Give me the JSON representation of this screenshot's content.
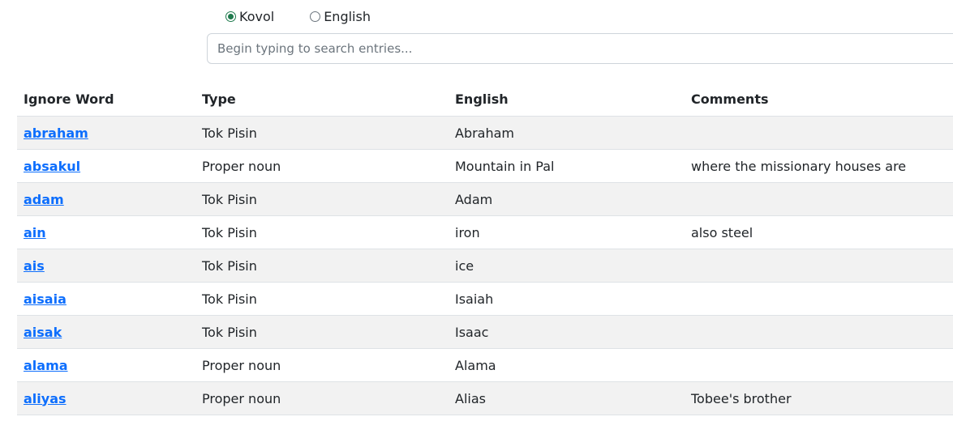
{
  "language_toggle": {
    "options": [
      {
        "label": "Kovol",
        "checked": true
      },
      {
        "label": "English",
        "checked": false
      }
    ],
    "accent_color": "#1f7a4d"
  },
  "search": {
    "placeholder": "Begin typing to search entries...",
    "value": ""
  },
  "table": {
    "headers": [
      "Ignore Word",
      "Type",
      "English",
      "Comments"
    ],
    "rows": [
      {
        "word": "abraham",
        "type": "Tok Pisin",
        "english": "Abraham",
        "comments": ""
      },
      {
        "word": "absakul",
        "type": "Proper noun",
        "english": "Mountain in Pal",
        "comments": "where the missionary houses are"
      },
      {
        "word": "adam",
        "type": "Tok Pisin",
        "english": "Adam",
        "comments": ""
      },
      {
        "word": "ain",
        "type": "Tok Pisin",
        "english": "iron",
        "comments": "also steel"
      },
      {
        "word": "ais",
        "type": "Tok Pisin",
        "english": "ice",
        "comments": ""
      },
      {
        "word": "aisaia",
        "type": "Tok Pisin",
        "english": "Isaiah",
        "comments": ""
      },
      {
        "word": "aisak",
        "type": "Tok Pisin",
        "english": "Isaac",
        "comments": ""
      },
      {
        "word": "alama",
        "type": "Proper noun",
        "english": "Alama",
        "comments": ""
      },
      {
        "word": "aliyas",
        "type": "Proper noun",
        "english": "Alias",
        "comments": "Tobee's brother"
      }
    ],
    "link_color": "#0d6efd"
  }
}
